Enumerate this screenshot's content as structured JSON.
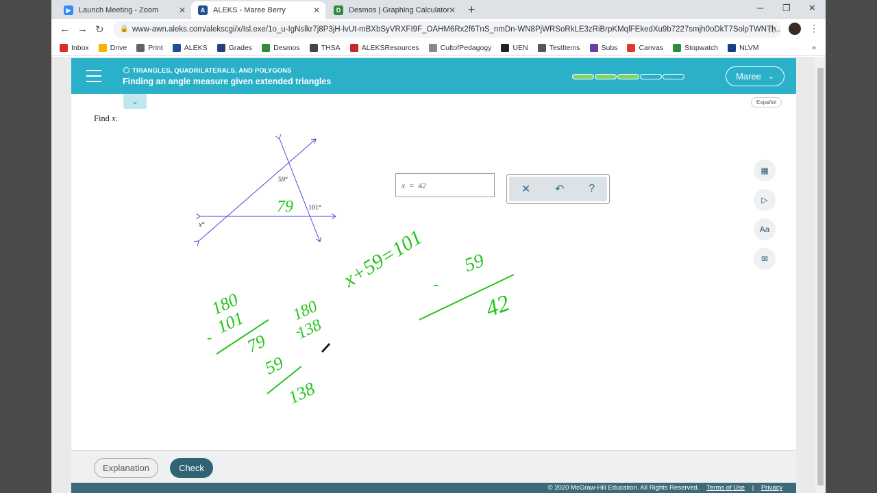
{
  "tabs": [
    {
      "title": "Launch Meeting - Zoom",
      "color": "#2d8cff"
    },
    {
      "title": "ALEKS - Maree Berry",
      "color": "#1f4f8c",
      "active": true
    },
    {
      "title": "Desmos | Graphing Calculator",
      "color": "#2f8a3b"
    }
  ],
  "address": {
    "url": "www-awn.aleks.com/alekscgi/x/Isl.exe/1o_u-IgNslkr7j8P3jH-lvUt-mBXbSyVRXFI9F_OAHM6Rx2f6TnS_nmDn-WN8PjWRSoRkLE3zRiBrpKMqlFEkedXu9b7227smjh0oDkT7SolpTWNTh..."
  },
  "bookmarks": [
    {
      "label": "Inbox",
      "color": "#d93025"
    },
    {
      "label": "Drive",
      "color": "#f4b400"
    },
    {
      "label": "Print",
      "color": "#5f6368"
    },
    {
      "label": "ALEKS",
      "color": "#1f4f8c"
    },
    {
      "label": "Grades",
      "color": "#2a3f7a"
    },
    {
      "label": "Desmos",
      "color": "#2f8a3b"
    },
    {
      "label": "THSA",
      "color": "#444"
    },
    {
      "label": "ALEKSResources",
      "color": "#c62828"
    },
    {
      "label": "CultofPedagogy",
      "color": "#888"
    },
    {
      "label": "UEN",
      "color": "#222"
    },
    {
      "label": "TestItems",
      "color": "#555"
    },
    {
      "label": "Subs",
      "color": "#6a3ca8"
    },
    {
      "label": "Canvas",
      "color": "#e2392b"
    },
    {
      "label": "Stopwatch",
      "color": "#2f8a3b"
    },
    {
      "label": "NLVM",
      "color": "#1a3c8c"
    }
  ],
  "header": {
    "topic": "TRIANGLES, QUADRILATERALS, AND POLYGONS",
    "subtopic": "Finding an angle measure given extended triangles",
    "progress_done": 3,
    "progress_total": 5,
    "user": "Maree"
  },
  "espanol": "Español",
  "problem": {
    "prompt_text": "Find ",
    "prompt_var": "x",
    "prompt_end": ".",
    "labels": {
      "top_angle": "59°",
      "right_angle": "101°",
      "left_angle": "x°"
    }
  },
  "answer": {
    "var": "x",
    "eq": "=",
    "value": "42"
  },
  "tools": {
    "clear": "✕",
    "undo": "↶",
    "help": "?"
  },
  "handwriting": {
    "inside_angle": "79",
    "equation": "x+59=101",
    "sub": "59",
    "result": "42",
    "work1_a": "180",
    "work1_b": "101",
    "work1_c": "79",
    "work1_d": "59",
    "work1_e": "138",
    "work2_a": "180",
    "work2_b": "138",
    "minus": "-"
  },
  "buttons": {
    "explanation": "Explanation",
    "check": "Check"
  },
  "footer": {
    "copyright": "© 2020 McGraw-Hill Education. All Rights Reserved.",
    "terms": "Terms of Use",
    "sep": "|",
    "privacy": "Privacy"
  },
  "colors": {
    "teal": "#2ab0c8",
    "ink": "#22c41a",
    "line": "#4444cc"
  }
}
